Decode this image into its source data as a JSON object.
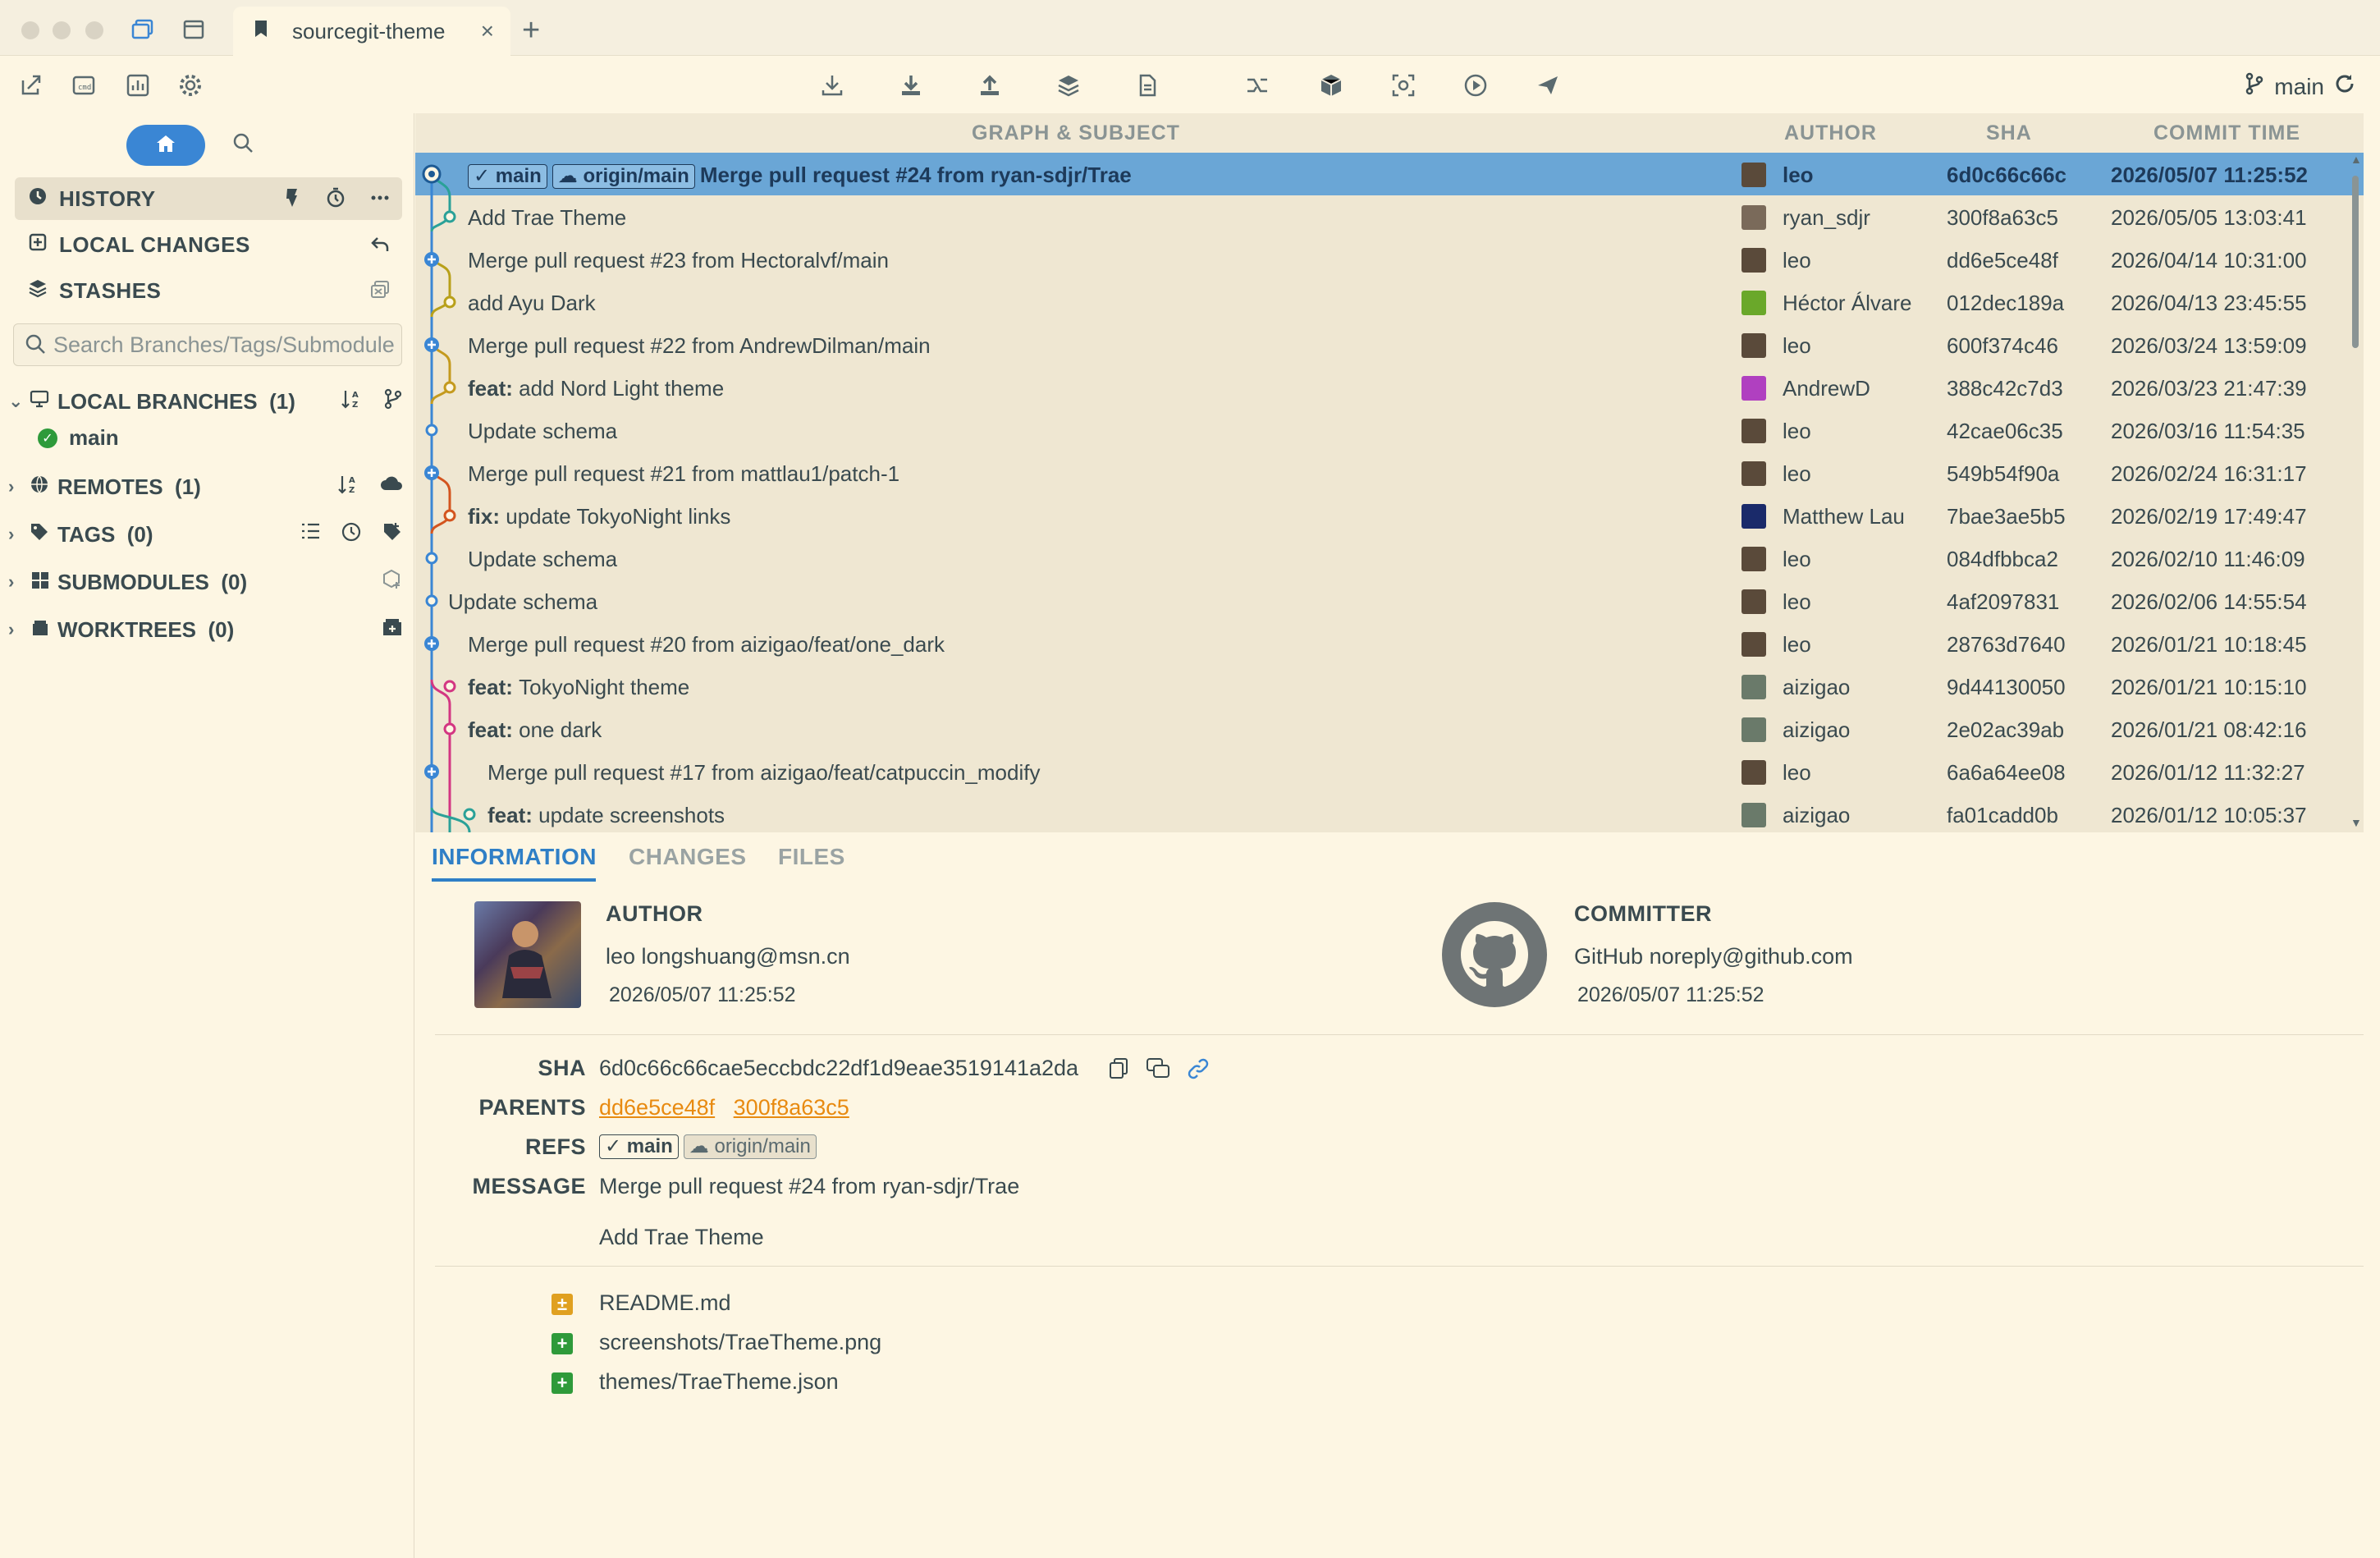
{
  "window": {
    "tab_title": "sourcegit-theme",
    "tab_close": "×",
    "new_tab": "+"
  },
  "toolbar": {
    "current_branch": "main"
  },
  "sidebar": {
    "history": "HISTORY",
    "local_changes": "LOCAL CHANGES",
    "stashes": "STASHES",
    "search_placeholder": "Search Branches/Tags/Submodule",
    "local_branches": "LOCAL BRANCHES",
    "local_branches_count": "(1)",
    "branch_main": "main",
    "remotes": "REMOTES",
    "remotes_count": "(1)",
    "tags": "TAGS",
    "tags_count": "(0)",
    "submodules": "SUBMODULES",
    "submodules_count": "(0)",
    "worktrees": "WORKTREES",
    "worktrees_count": "(0)"
  },
  "commit_list": {
    "headers": {
      "graph_subject": "GRAPH & SUBJECT",
      "author": "AUTHOR",
      "sha": "SHA",
      "commit_time": "COMMIT TIME"
    },
    "rows": [
      {
        "prefix": "",
        "subject": "Merge pull request #24 from ryan-sdjr/Trae",
        "author": "leo",
        "sha": "6d0c66c66c",
        "time": "2026/05/07 11:25:52",
        "refs": [
          "main",
          "origin/main"
        ]
      },
      {
        "prefix": "",
        "subject": "Add Trae Theme",
        "author": "ryan_sdjr",
        "sha": "300f8a63c5",
        "time": "2026/05/05 13:03:41"
      },
      {
        "prefix": "",
        "subject": "Merge pull request #23 from Hectoralvf/main",
        "author": "leo",
        "sha": "dd6e5ce48f",
        "time": "2026/04/14 10:31:00"
      },
      {
        "prefix": "",
        "subject": "add Ayu Dark",
        "author": "Héctor Álvare",
        "sha": "012dec189a",
        "time": "2026/04/13 23:45:55"
      },
      {
        "prefix": "",
        "subject": "Merge pull request #22 from AndrewDilman/main",
        "author": "leo",
        "sha": "600f374c46",
        "time": "2026/03/24 13:59:09"
      },
      {
        "prefix": "feat:",
        "subject": "add Nord Light theme",
        "author": "AndrewD",
        "sha": "388c42c7d3",
        "time": "2026/03/23 21:47:39"
      },
      {
        "prefix": "",
        "subject": "Update schema",
        "author": "leo",
        "sha": "42cae06c35",
        "time": "2026/03/16 11:54:35"
      },
      {
        "prefix": "",
        "subject": "Merge pull request #21 from mattlau1/patch-1",
        "author": "leo",
        "sha": "549b54f90a",
        "time": "2026/02/24 16:31:17"
      },
      {
        "prefix": "fix:",
        "subject": "update TokyoNight links",
        "author": "Matthew Lau",
        "sha": "7bae3ae5b5",
        "time": "2026/02/19 17:49:47"
      },
      {
        "prefix": "",
        "subject": "Update schema",
        "author": "leo",
        "sha": "084dfbbca2",
        "time": "2026/02/10 11:46:09"
      },
      {
        "prefix": "",
        "subject": "Update schema",
        "author": "leo",
        "sha": "4af2097831",
        "time": "2026/02/06 14:55:54"
      },
      {
        "prefix": "",
        "subject": "Merge pull request #20 from aizigao/feat/one_dark",
        "author": "leo",
        "sha": "28763d7640",
        "time": "2026/01/21 10:18:45"
      },
      {
        "prefix": "feat:",
        "subject": "TokyoNight theme",
        "author": "aizigao",
        "sha": "9d44130050",
        "time": "2026/01/21 10:15:10"
      },
      {
        "prefix": "feat:",
        "subject": "one dark",
        "author": "aizigao",
        "sha": "2e02ac39ab",
        "time": "2026/01/21 08:42:16"
      },
      {
        "prefix": "",
        "subject": "Merge pull request #17 from aizigao/feat/catpuccin_modify",
        "author": "leo",
        "sha": "6a6a64ee08",
        "time": "2026/01/12 11:32:27"
      },
      {
        "prefix": "feat:",
        "subject": "update screenshots",
        "author": "aizigao",
        "sha": "fa01cadd0b",
        "time": "2026/01/12 10:05:37"
      }
    ]
  },
  "detail": {
    "tabs": [
      "INFORMATION",
      "CHANGES",
      "FILES"
    ],
    "author_label": "AUTHOR",
    "author_name": "leo",
    "author_email": "longshuang@msn.cn",
    "author_time": "2026/05/07 11:25:52",
    "committer_label": "COMMITTER",
    "committer_name": "GitHub",
    "committer_email": "noreply@github.com",
    "committer_time": "2026/05/07 11:25:52",
    "sha_label": "SHA",
    "sha_value": "6d0c66c66cae5eccbdc22df1d9eae3519141a2da",
    "parents_label": "PARENTS",
    "parent1": "dd6e5ce48f",
    "parent2": "300f8a63c5",
    "refs_label": "REFS",
    "ref_main": "main",
    "ref_origin": "origin/main",
    "message_label": "MESSAGE",
    "message_line1": "Merge pull request #24 from ryan-sdjr/Trae",
    "message_line2": "Add Trae Theme",
    "files": [
      {
        "name": "README.md",
        "status": "±"
      },
      {
        "name": "screenshots/TraeTheme.png",
        "status": "+"
      },
      {
        "name": "themes/TraeTheme.json",
        "status": "+"
      }
    ]
  },
  "colors": {
    "background": "#fdf6e3",
    "accent": "#3a86d4",
    "selection": "#6aa6d6",
    "link": "#e88a10",
    "added": "#2e9a3a",
    "modified": "#e0a020"
  }
}
